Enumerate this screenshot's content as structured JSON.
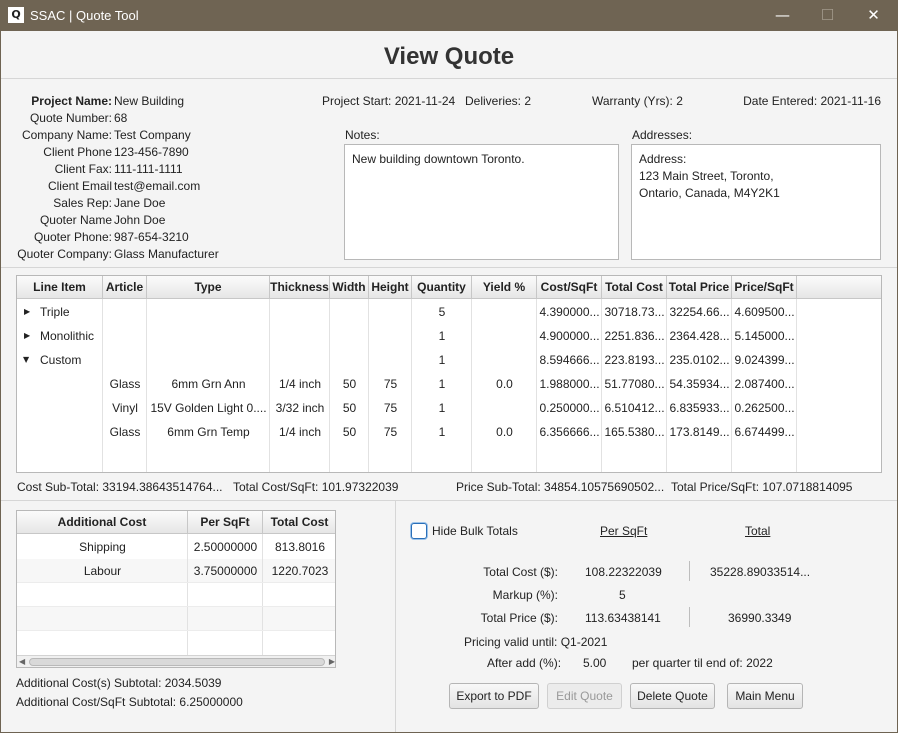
{
  "window": {
    "app_icon": "Q",
    "title": "SSAC | Quote Tool",
    "minimize_icon": "—",
    "maximize_icon": "☐",
    "close_icon": "✕"
  },
  "page_title": "View Quote",
  "project": {
    "project_name_label": "Project Name:",
    "project_name": "New Building",
    "quote_number_label": "Quote Number:",
    "quote_number": "68",
    "company_name_label": "Company Name:",
    "company_name": "Test Company",
    "client_phone_label": "Client Phone",
    "client_phone": "123-456-7890",
    "client_fax_label": "Client Fax:",
    "client_fax": "111-111-1111",
    "client_email_label": "Client Email",
    "client_email": "test@email.com",
    "sales_rep_label": "Sales Rep:",
    "sales_rep": "Jane Doe",
    "quoter_name_label": "Quoter Name",
    "quoter_name": "John Doe",
    "quoter_phone_label": "Quoter Phone:",
    "quoter_phone": "987-654-3210",
    "quoter_company_label": "Quoter Company:",
    "quoter_company": "Glass Manufacturer"
  },
  "header_info": {
    "project_start": "Project Start: 2021-11-24",
    "deliveries": "Deliveries: 2",
    "warranty": "Warranty (Yrs): 2",
    "date_entered": "Date Entered: 2021-11-16"
  },
  "notes": {
    "label": "Notes:",
    "value": "New building downtown Toronto."
  },
  "addresses": {
    "label": "Addresses:",
    "value": "Address:\n123 Main Street, Toronto,\nOntario, Canada, M4Y2K1"
  },
  "line_items": {
    "columns": [
      "Line Item",
      "Article",
      "Type",
      "Thickness",
      "Width",
      "Height",
      "Quantity",
      "Yield %",
      "Cost/SqFt",
      "Total Cost",
      "Total Price",
      "Price/SqFt"
    ],
    "expand_icon": "▶",
    "collapse_icon": "▼",
    "rows": [
      {
        "line_item": "Triple",
        "article": "",
        "type": "",
        "thickness": "",
        "width": "",
        "height": "",
        "quantity": "5",
        "yield": "",
        "cost_sqft": "4.390000...",
        "total_cost": "30718.73...",
        "total_price": "32254.66...",
        "price_sqft": "4.609500..."
      },
      {
        "line_item": "Monolithic",
        "article": "",
        "type": "",
        "thickness": "",
        "width": "",
        "height": "",
        "quantity": "1",
        "yield": "",
        "cost_sqft": "4.900000...",
        "total_cost": "2251.836...",
        "total_price": "2364.428...",
        "price_sqft": "5.145000..."
      },
      {
        "line_item": "Custom",
        "article": "",
        "type": "",
        "thickness": "",
        "width": "",
        "height": "",
        "quantity": "1",
        "yield": "",
        "cost_sqft": "8.594666...",
        "total_cost": "223.8193...",
        "total_price": "235.0102...",
        "price_sqft": "9.024399..."
      },
      {
        "line_item": "",
        "article": "Glass",
        "type": "6mm Grn Ann",
        "thickness": "1/4 inch",
        "width": "50",
        "height": "75",
        "quantity": "1",
        "yield": "0.0",
        "cost_sqft": "1.988000...",
        "total_cost": "51.77080...",
        "total_price": "54.35934...",
        "price_sqft": "2.087400..."
      },
      {
        "line_item": "",
        "article": "Vinyl",
        "type": "15V Golden Light 0....",
        "thickness": "3/32 inch",
        "width": "50",
        "height": "75",
        "quantity": "1",
        "yield": "",
        "cost_sqft": "0.250000...",
        "total_cost": "6.510412...",
        "total_price": "6.835933...",
        "price_sqft": "0.262500..."
      },
      {
        "line_item": "",
        "article": "Glass",
        "type": "6mm Grn Temp",
        "thickness": "1/4 inch",
        "width": "50",
        "height": "75",
        "quantity": "1",
        "yield": "0.0",
        "cost_sqft": "6.356666...",
        "total_cost": "165.5380...",
        "total_price": "173.8149...",
        "price_sqft": "6.674499..."
      }
    ]
  },
  "subtotals": {
    "cost_subtotal": "Cost Sub-Total:  33194.38643514764...",
    "total_cost_sqft": "Total Cost/SqFt: 101.97322039",
    "price_subtotal": "Price Sub-Total: 34854.10575690502...",
    "total_price_sqft": "Total Price/SqFt: 107.0718814095"
  },
  "additional_costs": {
    "columns": [
      "Additional Cost",
      "Per SqFt",
      "Total Cost"
    ],
    "rows": [
      {
        "name": "Shipping",
        "per_sqft": "2.50000000",
        "total": "813.8016"
      },
      {
        "name": "Labour",
        "per_sqft": "3.75000000",
        "total": "1220.7023"
      }
    ],
    "subtotal": "Additional Cost(s) Subtotal: 2034.5039",
    "sqft_subtotal": "Additional Cost/SqFt Subtotal: 6.25000000"
  },
  "totals": {
    "hide_bulk_label": "Hide Bulk Totals",
    "hide_bulk_checked": false,
    "per_sqft_header": "Per SqFt",
    "total_header": "Total",
    "total_cost_label": "Total Cost ($):",
    "total_cost_per_sqft": "108.22322039",
    "total_cost_total": "35228.89033514...",
    "markup_label": "Markup (%):",
    "markup_value": "5",
    "total_price_label": "Total Price ($):",
    "total_price_per_sqft": "113.63438141",
    "total_price_total": "36990.3349",
    "pricing_valid": "Pricing valid until: Q1-2021",
    "after_add_label": "After add (%):",
    "after_add_value": "5.00",
    "per_quarter": "per quarter til end of: 2022"
  },
  "buttons": {
    "export_pdf": "Export to PDF",
    "edit_quote": "Edit Quote",
    "delete_quote": "Delete Quote",
    "main_menu": "Main Menu"
  }
}
